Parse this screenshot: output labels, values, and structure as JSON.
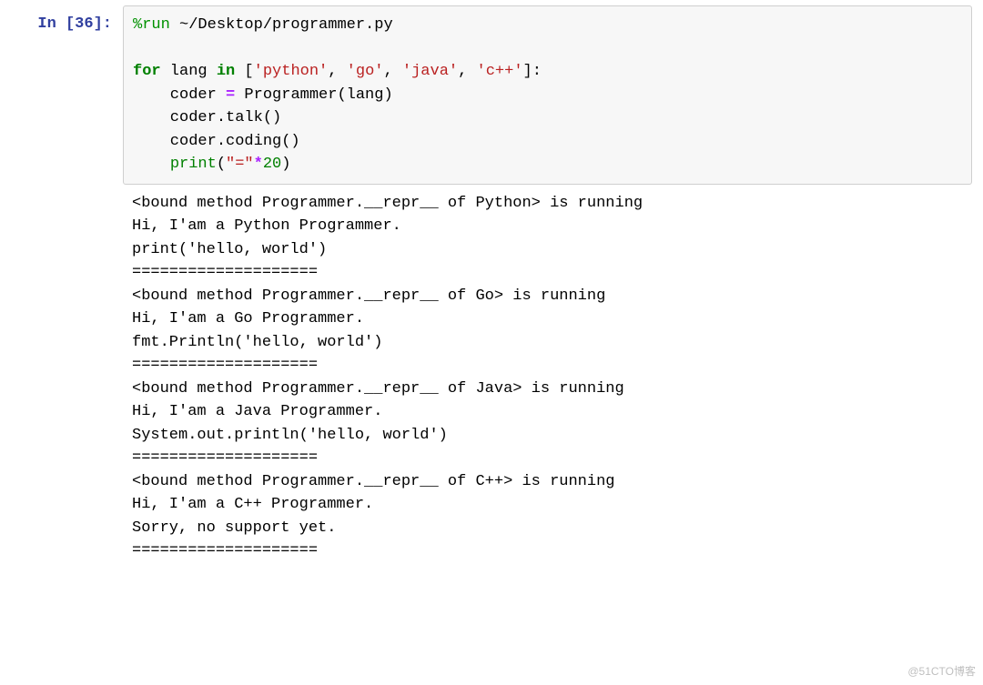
{
  "cell": {
    "prompt": "In [36]:",
    "code": {
      "tokens": [
        {
          "cls": "tok-magic",
          "t": "%run"
        },
        {
          "cls": "tok-plain",
          "t": " ~/Desktop/programmer.py\n\n"
        },
        {
          "cls": "tok-kw",
          "t": "for"
        },
        {
          "cls": "tok-plain",
          "t": " lang "
        },
        {
          "cls": "tok-kw",
          "t": "in"
        },
        {
          "cls": "tok-plain",
          "t": " ["
        },
        {
          "cls": "tok-str",
          "t": "'python'"
        },
        {
          "cls": "tok-plain",
          "t": ", "
        },
        {
          "cls": "tok-str",
          "t": "'go'"
        },
        {
          "cls": "tok-plain",
          "t": ", "
        },
        {
          "cls": "tok-str",
          "t": "'java'"
        },
        {
          "cls": "tok-plain",
          "t": ", "
        },
        {
          "cls": "tok-str",
          "t": "'c++'"
        },
        {
          "cls": "tok-plain",
          "t": "]:\n    coder "
        },
        {
          "cls": "tok-op",
          "t": "="
        },
        {
          "cls": "tok-plain",
          "t": " Programmer(lang)\n    coder.talk()\n    coder.coding()\n    "
        },
        {
          "cls": "tok-builtin",
          "t": "print"
        },
        {
          "cls": "tok-plain",
          "t": "("
        },
        {
          "cls": "tok-str",
          "t": "\"=\""
        },
        {
          "cls": "tok-op",
          "t": "*"
        },
        {
          "cls": "tok-num",
          "t": "20"
        },
        {
          "cls": "tok-plain",
          "t": ")"
        }
      ]
    },
    "output": "<bound method Programmer.__repr__ of Python> is running\nHi, I'am a Python Programmer.\nprint('hello, world')\n====================\n<bound method Programmer.__repr__ of Go> is running\nHi, I'am a Go Programmer.\nfmt.Println('hello, world')\n====================\n<bound method Programmer.__repr__ of Java> is running\nHi, I'am a Java Programmer.\nSystem.out.println('hello, world')\n====================\n<bound method Programmer.__repr__ of C++> is running\nHi, I'am a C++ Programmer.\nSorry, no support yet.\n===================="
  },
  "watermark": "@51CTO博客"
}
